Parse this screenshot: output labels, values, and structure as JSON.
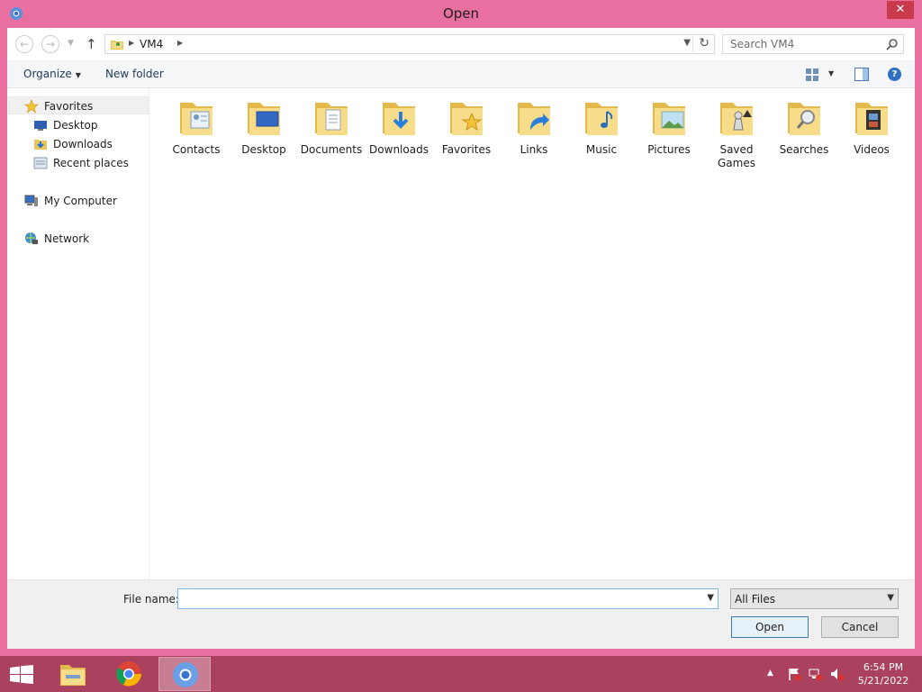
{
  "window": {
    "title": "Open",
    "close_label": "✕"
  },
  "address_bar": {
    "path": "VM4",
    "search_placeholder": "Search VM4"
  },
  "command_bar": {
    "organize_label": "Organize",
    "new_folder_label": "New folder",
    "help_label": "?"
  },
  "nav_pane": {
    "favorites": "Favorites",
    "desktop": "Desktop",
    "downloads": "Downloads",
    "recent_places": "Recent places",
    "my_computer": "My Computer",
    "network": "Network"
  },
  "folders": [
    {
      "label": "Contacts",
      "icon": "contacts-folder-icon"
    },
    {
      "label": "Desktop",
      "icon": "desktop-folder-icon"
    },
    {
      "label": "Documents",
      "icon": "documents-folder-icon"
    },
    {
      "label": "Downloads",
      "icon": "downloads-folder-icon"
    },
    {
      "label": "Favorites",
      "icon": "favorites-folder-icon"
    },
    {
      "label": "Links",
      "icon": "links-folder-icon"
    },
    {
      "label": "Music",
      "icon": "music-folder-icon"
    },
    {
      "label": "Pictures",
      "icon": "pictures-folder-icon"
    },
    {
      "label": "Saved Games",
      "icon": "saved-games-folder-icon"
    },
    {
      "label": "Searches",
      "icon": "searches-folder-icon"
    },
    {
      "label": "Videos",
      "icon": "videos-folder-icon"
    }
  ],
  "bottom": {
    "file_name_label": "File name:",
    "file_name_value": "",
    "file_type": "All Files",
    "open_label": "Open",
    "cancel_label": "Cancel"
  },
  "taskbar": {
    "time": "6:54 PM",
    "date": "5/21/2022"
  },
  "colors": {
    "window_frame": "#e96fa1",
    "taskbar": "#a9415f",
    "folder_yellow": "#f4d27a"
  }
}
